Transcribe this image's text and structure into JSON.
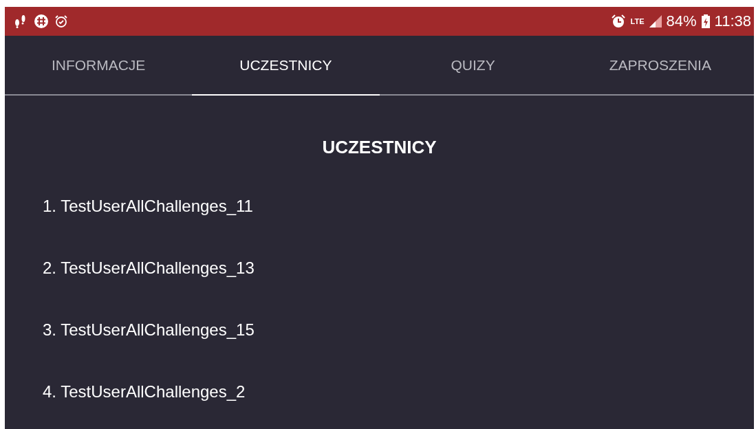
{
  "status_bar": {
    "network": "LTE",
    "battery": "84%",
    "time": "11:38"
  },
  "tabs": [
    {
      "label": "INFORMACJE",
      "selected": false
    },
    {
      "label": "UCZESTNICY",
      "selected": true
    },
    {
      "label": "QUIZY",
      "selected": false
    },
    {
      "label": "ZAPROSZENIA",
      "selected": false
    }
  ],
  "heading": "UCZESTNICY",
  "participants": [
    "1. TestUserAllChallenges_11",
    "2. TestUserAllChallenges_13",
    "3. TestUserAllChallenges_15",
    "4. TestUserAllChallenges_2"
  ]
}
